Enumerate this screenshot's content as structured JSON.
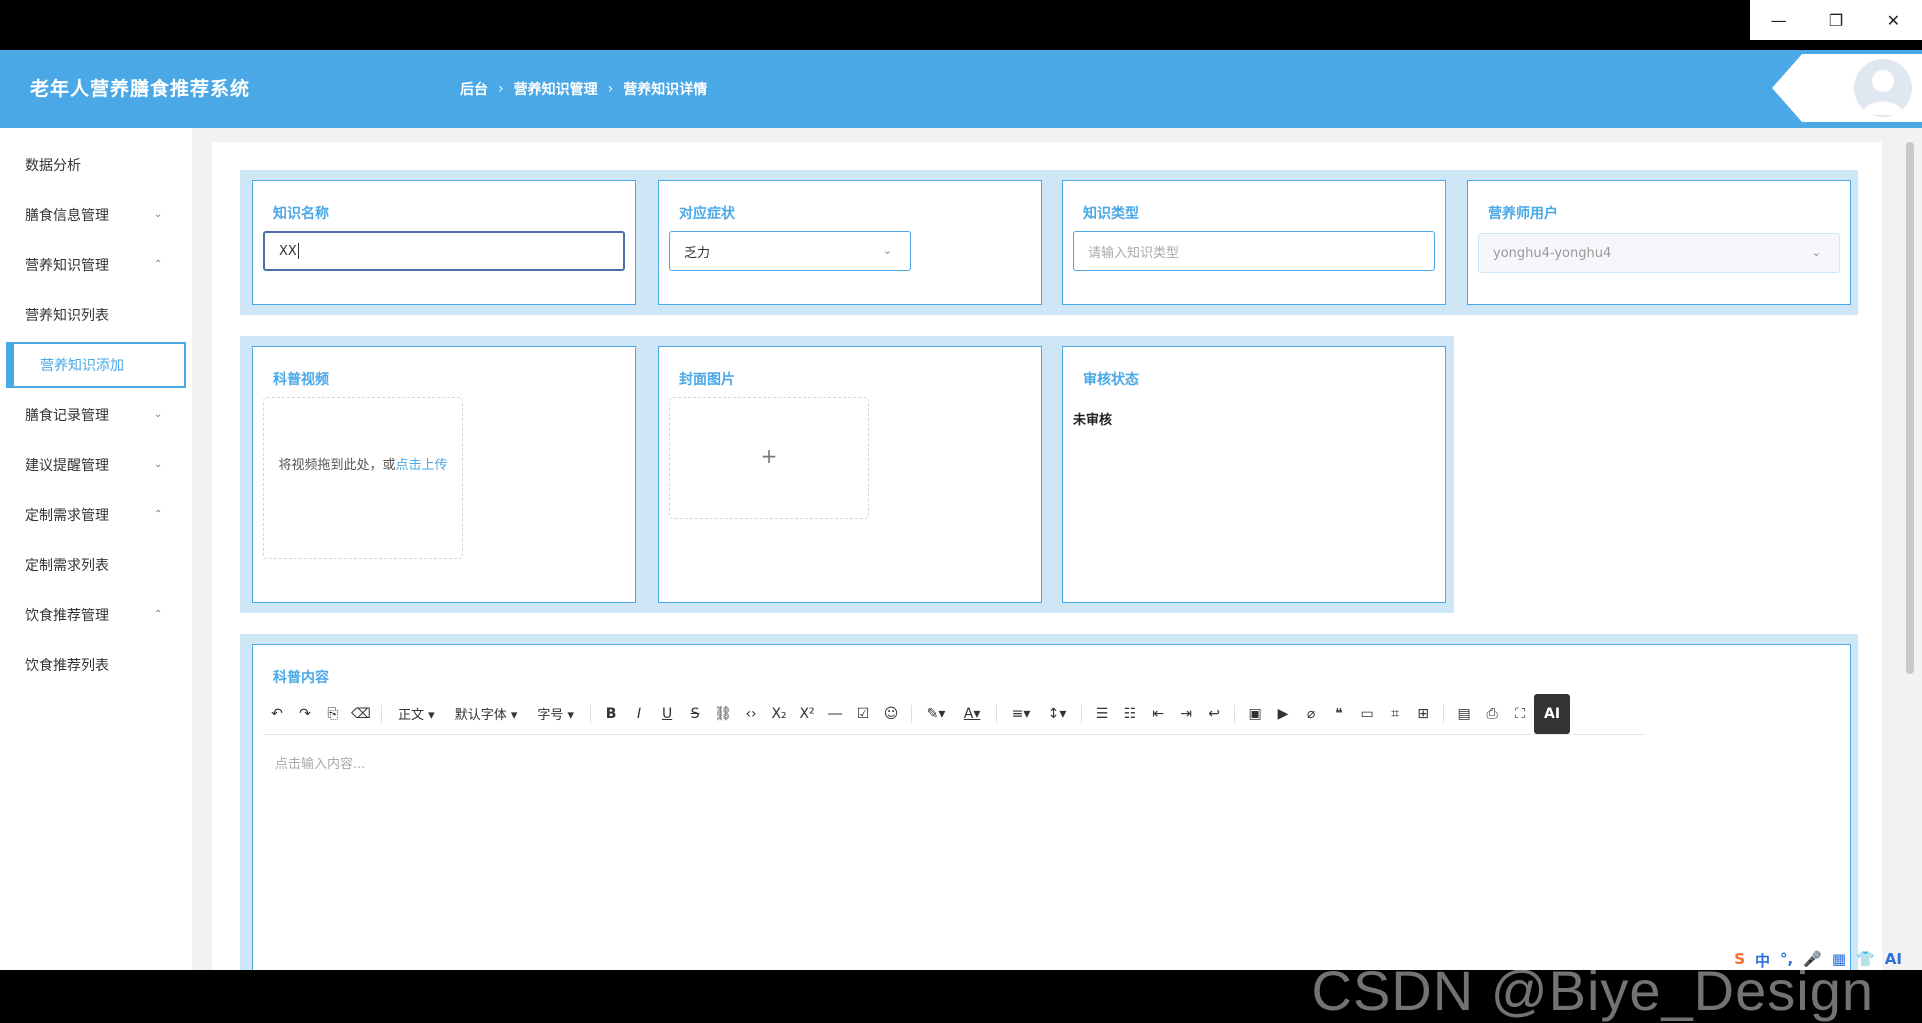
{
  "window": {
    "minimize": "—",
    "restore": "❐",
    "close": "✕"
  },
  "header": {
    "brand": "老年人营养膳食推荐系统",
    "breadcrumb": [
      "后台",
      "营养知识管理",
      "营养知识详情"
    ],
    "separator": "›"
  },
  "sidebar": {
    "items": [
      {
        "label": "数据分析",
        "chevron": ""
      },
      {
        "label": "膳食信息管理",
        "chevron": "⌄"
      },
      {
        "label": "营养知识管理",
        "chevron": "⌃"
      },
      {
        "label": "营养知识列表",
        "chevron": ""
      },
      {
        "label": "营养知识添加",
        "chevron": ""
      },
      {
        "label": "膳食记录管理",
        "chevron": "⌄"
      },
      {
        "label": "建议提醒管理",
        "chevron": "⌄"
      },
      {
        "label": "定制需求管理",
        "chevron": "⌃"
      },
      {
        "label": "定制需求列表",
        "chevron": ""
      },
      {
        "label": "饮食推荐管理",
        "chevron": "⌃"
      },
      {
        "label": "饮食推荐列表",
        "chevron": ""
      }
    ]
  },
  "form": {
    "name": {
      "label": "知识名称",
      "value": "XX"
    },
    "symptom": {
      "label": "对应症状",
      "value": "乏力"
    },
    "type": {
      "label": "知识类型",
      "placeholder": "请输入知识类型"
    },
    "nutritionist": {
      "label": "营养师用户",
      "value": "yonghu4-yonghu4"
    },
    "video": {
      "label": "科普视频",
      "hint": "将视频拖到此处，或",
      "link": "点击上传"
    },
    "cover": {
      "label": "封面图片",
      "plus": "+"
    },
    "status": {
      "label": "审核状态",
      "value": "未审核"
    },
    "content": {
      "label": "科普内容",
      "placeholder": "点击输入内容..."
    }
  },
  "toolbar": {
    "paragraph": "正文",
    "font": "默认字体",
    "size": "字号",
    "ai": "AI"
  },
  "watermark": "CSDN @Biye_Design",
  "ime": {
    "logo": "S",
    "lang": "中",
    "items": [
      "°,",
      "🎤",
      "▦",
      "👕",
      "AI"
    ]
  },
  "colors": {
    "accent": "#4ba8e6",
    "band": "#cfe6f7"
  }
}
